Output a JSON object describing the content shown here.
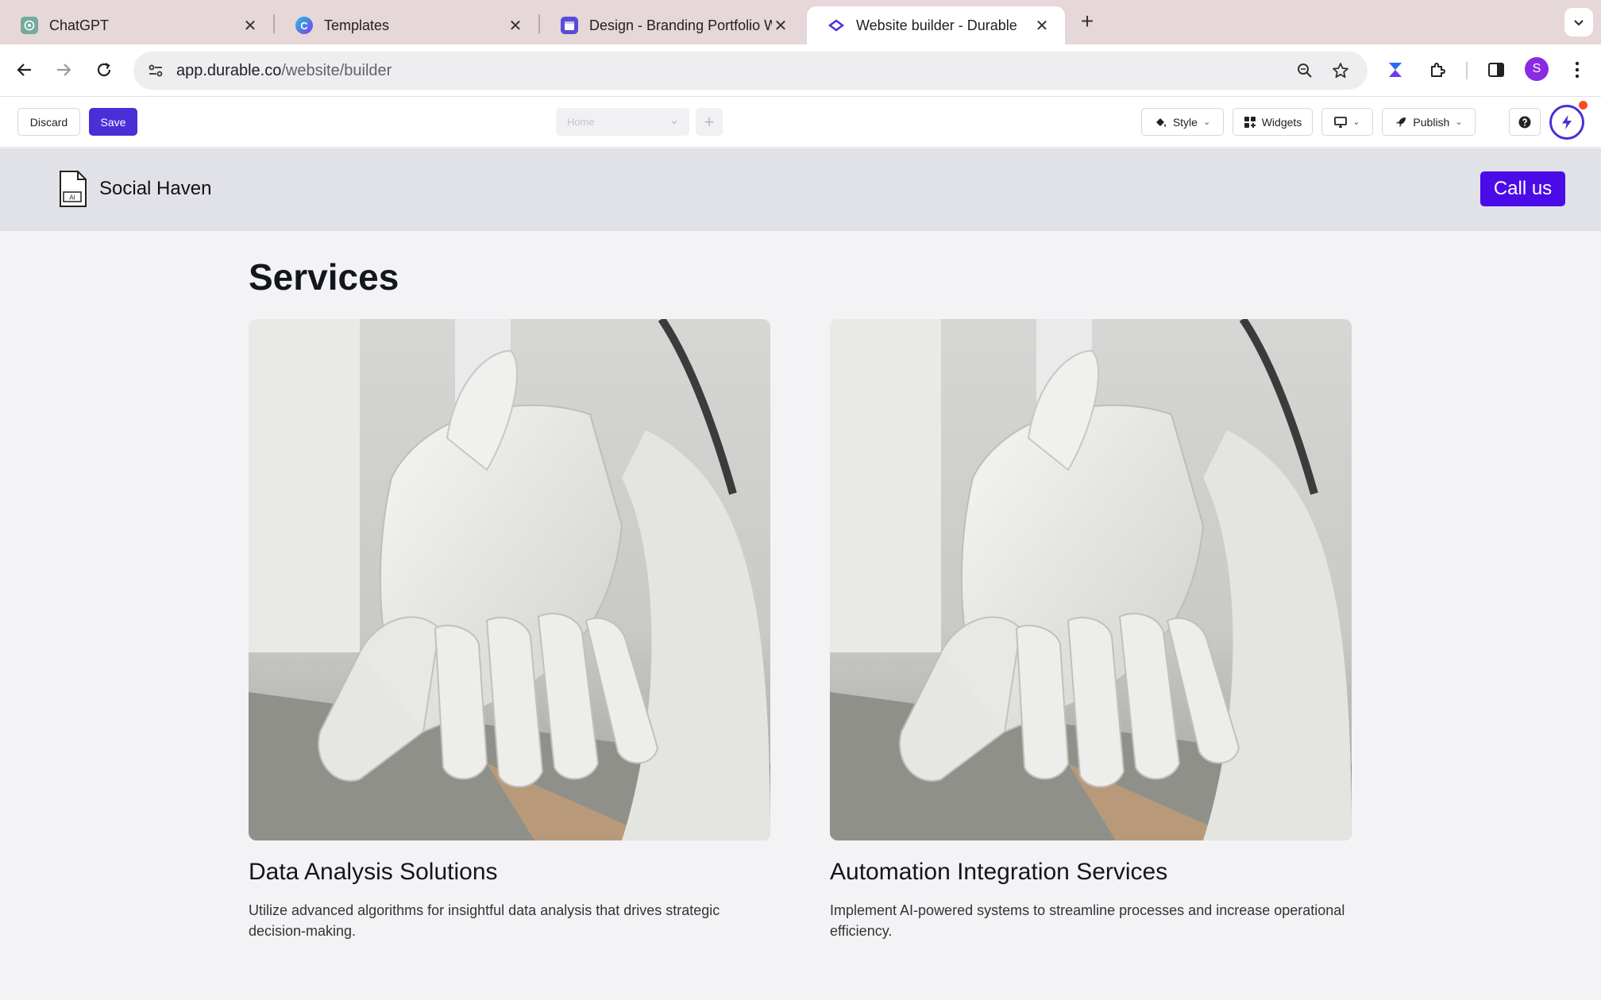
{
  "browser": {
    "tabs": [
      {
        "title": "ChatGPT",
        "icon": "chatgpt-icon",
        "active": false
      },
      {
        "title": "Templates",
        "icon": "canva-icon",
        "active": false
      },
      {
        "title": "Design - Branding Portfolio W",
        "icon": "calendar-icon",
        "active": false
      },
      {
        "title": "Website builder - Durable",
        "icon": "durable-icon",
        "active": true
      }
    ],
    "url_host": "app.durable.co",
    "url_path": "/website/builder",
    "profile_initial": "S"
  },
  "builder": {
    "discard_label": "Discard",
    "save_label": "Save",
    "page_select_value": "Home",
    "style_label": "Style",
    "widgets_label": "Widgets",
    "publish_label": "Publish"
  },
  "site": {
    "brand_name": "Social Haven",
    "logo_text": "AI",
    "cta_label": "Call us",
    "services_title": "Services",
    "services": [
      {
        "title": "Data Analysis Solutions",
        "description": "Utilize advanced algorithms for insightful data analysis that drives strategic decision-making."
      },
      {
        "title": "Automation Integration Services",
        "description": "Implement AI-powered systems to streamline processes and increase operational efficiency."
      }
    ]
  },
  "colors": {
    "accent": "#4b2fd6",
    "cta": "#4b0be8",
    "tab_strip": "#e6d7d8",
    "header_bg": "#e1e1e8"
  }
}
